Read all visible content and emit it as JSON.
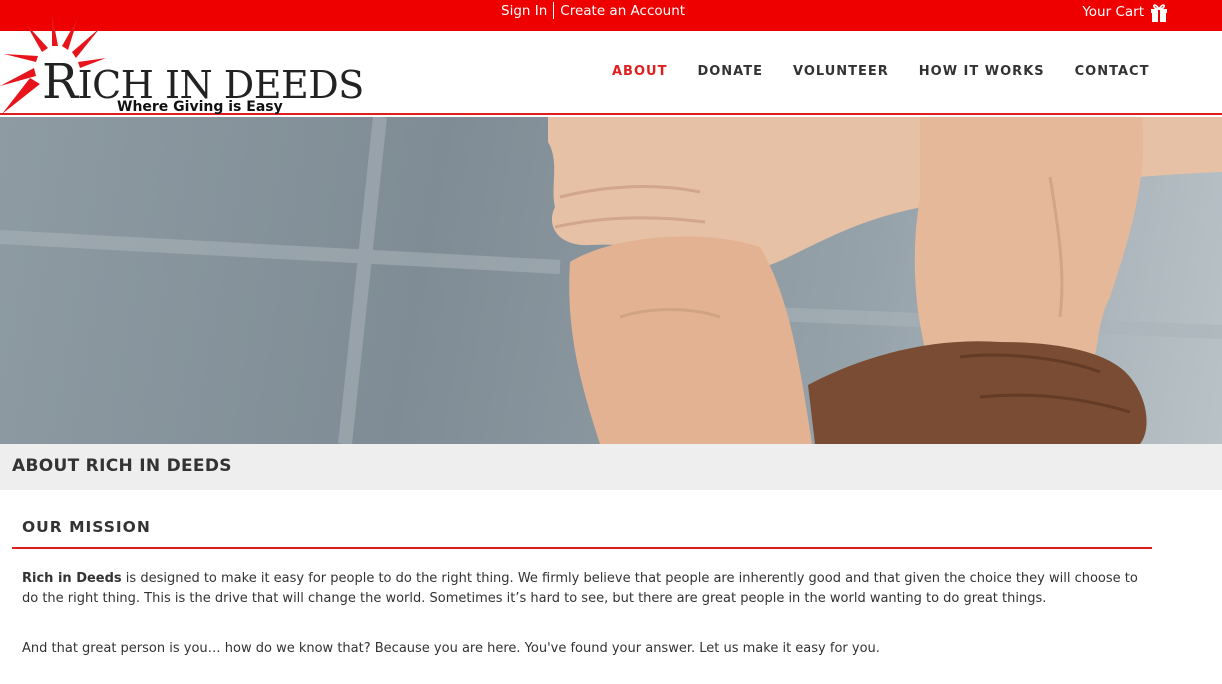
{
  "topbar": {
    "sign_in": "Sign In",
    "create_account": "Create an Account",
    "cart": "Your Cart",
    "bg_color": "#ef0000"
  },
  "logo": {
    "title_rich": "R",
    "title_rest": "ICH IN DEEDS",
    "tagline": "Where Giving is Easy"
  },
  "nav": {
    "items": [
      {
        "label": "ABOUT",
        "active": true
      },
      {
        "label": "DONATE",
        "active": false
      },
      {
        "label": "VOLUNTEER",
        "active": false
      },
      {
        "label": "HOW IT WORKS",
        "active": false
      },
      {
        "label": "CONTACT",
        "active": false
      }
    ],
    "accent": "#e01e1e"
  },
  "page": {
    "title": "ABOUT RICH IN DEEDS",
    "section_heading": "OUR MISSION",
    "p1_bold": "Rich in Deeds",
    "p1_text": " is designed to make it easy for people to do the right thing. We firmly believe that people are inherently good and that given the choice they will choose to do the right thing. This is the drive that will change the world. Sometimes it’s hard to see, but there are great people in the world wanting to do great things.",
    "p2_text": "And that great person is you… how do we know that? Because you are here. You've found your answer. Let us make it easy for you."
  }
}
